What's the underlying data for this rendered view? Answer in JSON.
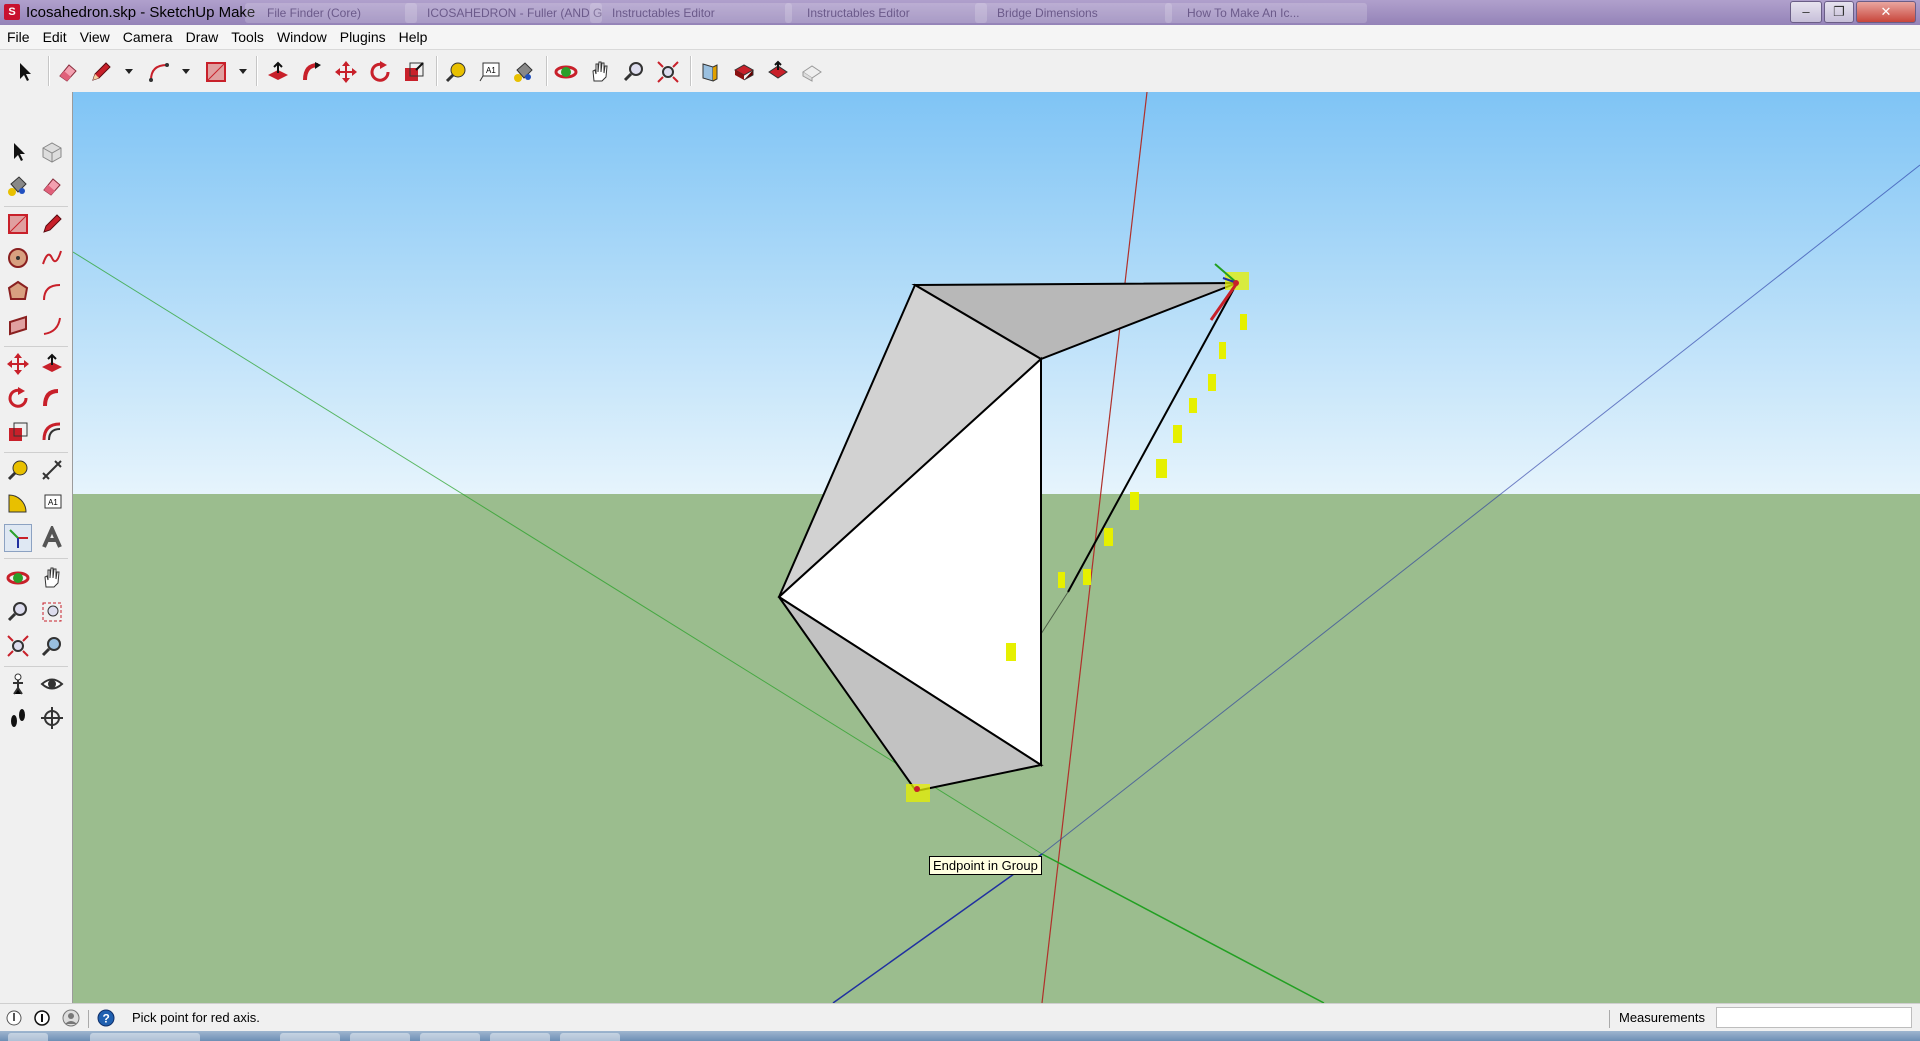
{
  "window": {
    "title": "Icosahedron.skp - SketchUp Make",
    "background_tabs": [
      "File Finder (Core)",
      "ICOSAHEDRON - Fuller (AND GEO...",
      "Instructables Editor",
      "Instructables Editor",
      "Bridge Dimensions",
      "How To Make An Ic..."
    ],
    "controls": [
      "minimize",
      "maximize",
      "close"
    ]
  },
  "menu": [
    "File",
    "Edit",
    "View",
    "Camera",
    "Draw",
    "Tools",
    "Window",
    "Plugins",
    "Help"
  ],
  "toolbar_icons": [
    "select-icon",
    "eraser-icon",
    "pencil-icon",
    "arc-icon",
    "rectangle-icon",
    "push-pull-icon",
    "follow-me-icon",
    "move-icon",
    "rotate-icon",
    "scale-icon",
    "tape-measure-icon",
    "text-icon",
    "paint-bucket-icon",
    "orbit-icon",
    "pan-icon",
    "zoom-icon",
    "zoom-extents-icon",
    "section-plane-icon",
    "get-models-icon",
    "share-model-icon",
    "share-component-icon"
  ],
  "left_toolbar_icons": [
    "select-icon",
    "make-component-icon",
    "paint-bucket-icon",
    "eraser-icon",
    "rectangle-icon",
    "line-icon",
    "circle-icon",
    "freehand-icon",
    "polygon-icon",
    "arc-icon",
    "rotated-rectangle-icon",
    "two-point-arc-icon",
    "move-icon",
    "push-pull-icon",
    "rotate-icon",
    "follow-me-icon",
    "scale-icon",
    "offset-icon",
    "tape-measure-icon",
    "dimension-icon",
    "protractor-icon",
    "text-icon",
    "axes-icon",
    "3d-text-icon",
    "orbit-icon",
    "pan-icon",
    "zoom-icon",
    "zoom-window-icon",
    "zoom-extents-icon",
    "previous-view-icon",
    "position-camera-icon",
    "look-around-icon",
    "walk-icon",
    "section-plane-icon"
  ],
  "viewport": {
    "tooltip": "Endpoint in Group",
    "colors": {
      "sky_top": "#7fc4f5",
      "sky_bottom": "#e6f4fc",
      "ground": "#9bbd8e",
      "red_axis": "#b0302a",
      "green_axis": "#22a022",
      "blue_axis": "#2030a0",
      "inference": "#e6f000"
    }
  },
  "status": {
    "text": "Pick point for red axis.",
    "measurements_label": "Measurements",
    "measurements_value": ""
  }
}
